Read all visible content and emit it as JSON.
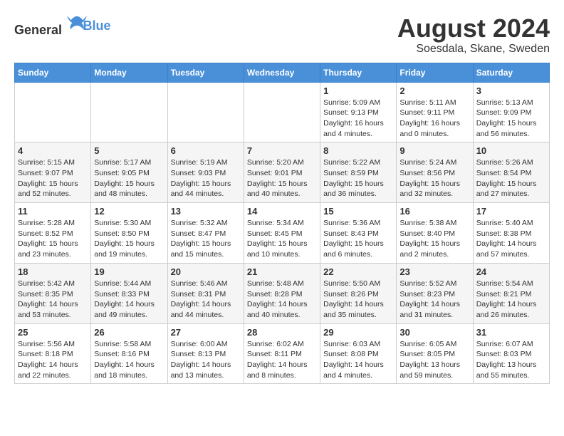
{
  "header": {
    "logo_general": "General",
    "logo_blue": "Blue",
    "title": "August 2024",
    "subtitle": "Soesdala, Skane, Sweden"
  },
  "days_of_week": [
    "Sunday",
    "Monday",
    "Tuesday",
    "Wednesday",
    "Thursday",
    "Friday",
    "Saturday"
  ],
  "weeks": [
    [
      {
        "day": "",
        "info": ""
      },
      {
        "day": "",
        "info": ""
      },
      {
        "day": "",
        "info": ""
      },
      {
        "day": "",
        "info": ""
      },
      {
        "day": "1",
        "info": "Sunrise: 5:09 AM\nSunset: 9:13 PM\nDaylight: 16 hours\nand 4 minutes."
      },
      {
        "day": "2",
        "info": "Sunrise: 5:11 AM\nSunset: 9:11 PM\nDaylight: 16 hours\nand 0 minutes."
      },
      {
        "day": "3",
        "info": "Sunrise: 5:13 AM\nSunset: 9:09 PM\nDaylight: 15 hours\nand 56 minutes."
      }
    ],
    [
      {
        "day": "4",
        "info": "Sunrise: 5:15 AM\nSunset: 9:07 PM\nDaylight: 15 hours\nand 52 minutes."
      },
      {
        "day": "5",
        "info": "Sunrise: 5:17 AM\nSunset: 9:05 PM\nDaylight: 15 hours\nand 48 minutes."
      },
      {
        "day": "6",
        "info": "Sunrise: 5:19 AM\nSunset: 9:03 PM\nDaylight: 15 hours\nand 44 minutes."
      },
      {
        "day": "7",
        "info": "Sunrise: 5:20 AM\nSunset: 9:01 PM\nDaylight: 15 hours\nand 40 minutes."
      },
      {
        "day": "8",
        "info": "Sunrise: 5:22 AM\nSunset: 8:59 PM\nDaylight: 15 hours\nand 36 minutes."
      },
      {
        "day": "9",
        "info": "Sunrise: 5:24 AM\nSunset: 8:56 PM\nDaylight: 15 hours\nand 32 minutes."
      },
      {
        "day": "10",
        "info": "Sunrise: 5:26 AM\nSunset: 8:54 PM\nDaylight: 15 hours\nand 27 minutes."
      }
    ],
    [
      {
        "day": "11",
        "info": "Sunrise: 5:28 AM\nSunset: 8:52 PM\nDaylight: 15 hours\nand 23 minutes."
      },
      {
        "day": "12",
        "info": "Sunrise: 5:30 AM\nSunset: 8:50 PM\nDaylight: 15 hours\nand 19 minutes."
      },
      {
        "day": "13",
        "info": "Sunrise: 5:32 AM\nSunset: 8:47 PM\nDaylight: 15 hours\nand 15 minutes."
      },
      {
        "day": "14",
        "info": "Sunrise: 5:34 AM\nSunset: 8:45 PM\nDaylight: 15 hours\nand 10 minutes."
      },
      {
        "day": "15",
        "info": "Sunrise: 5:36 AM\nSunset: 8:43 PM\nDaylight: 15 hours\nand 6 minutes."
      },
      {
        "day": "16",
        "info": "Sunrise: 5:38 AM\nSunset: 8:40 PM\nDaylight: 15 hours\nand 2 minutes."
      },
      {
        "day": "17",
        "info": "Sunrise: 5:40 AM\nSunset: 8:38 PM\nDaylight: 14 hours\nand 57 minutes."
      }
    ],
    [
      {
        "day": "18",
        "info": "Sunrise: 5:42 AM\nSunset: 8:35 PM\nDaylight: 14 hours\nand 53 minutes."
      },
      {
        "day": "19",
        "info": "Sunrise: 5:44 AM\nSunset: 8:33 PM\nDaylight: 14 hours\nand 49 minutes."
      },
      {
        "day": "20",
        "info": "Sunrise: 5:46 AM\nSunset: 8:31 PM\nDaylight: 14 hours\nand 44 minutes."
      },
      {
        "day": "21",
        "info": "Sunrise: 5:48 AM\nSunset: 8:28 PM\nDaylight: 14 hours\nand 40 minutes."
      },
      {
        "day": "22",
        "info": "Sunrise: 5:50 AM\nSunset: 8:26 PM\nDaylight: 14 hours\nand 35 minutes."
      },
      {
        "day": "23",
        "info": "Sunrise: 5:52 AM\nSunset: 8:23 PM\nDaylight: 14 hours\nand 31 minutes."
      },
      {
        "day": "24",
        "info": "Sunrise: 5:54 AM\nSunset: 8:21 PM\nDaylight: 14 hours\nand 26 minutes."
      }
    ],
    [
      {
        "day": "25",
        "info": "Sunrise: 5:56 AM\nSunset: 8:18 PM\nDaylight: 14 hours\nand 22 minutes."
      },
      {
        "day": "26",
        "info": "Sunrise: 5:58 AM\nSunset: 8:16 PM\nDaylight: 14 hours\nand 18 minutes."
      },
      {
        "day": "27",
        "info": "Sunrise: 6:00 AM\nSunset: 8:13 PM\nDaylight: 14 hours\nand 13 minutes."
      },
      {
        "day": "28",
        "info": "Sunrise: 6:02 AM\nSunset: 8:11 PM\nDaylight: 14 hours\nand 8 minutes."
      },
      {
        "day": "29",
        "info": "Sunrise: 6:03 AM\nSunset: 8:08 PM\nDaylight: 14 hours\nand 4 minutes."
      },
      {
        "day": "30",
        "info": "Sunrise: 6:05 AM\nSunset: 8:05 PM\nDaylight: 13 hours\nand 59 minutes."
      },
      {
        "day": "31",
        "info": "Sunrise: 6:07 AM\nSunset: 8:03 PM\nDaylight: 13 hours\nand 55 minutes."
      }
    ]
  ]
}
